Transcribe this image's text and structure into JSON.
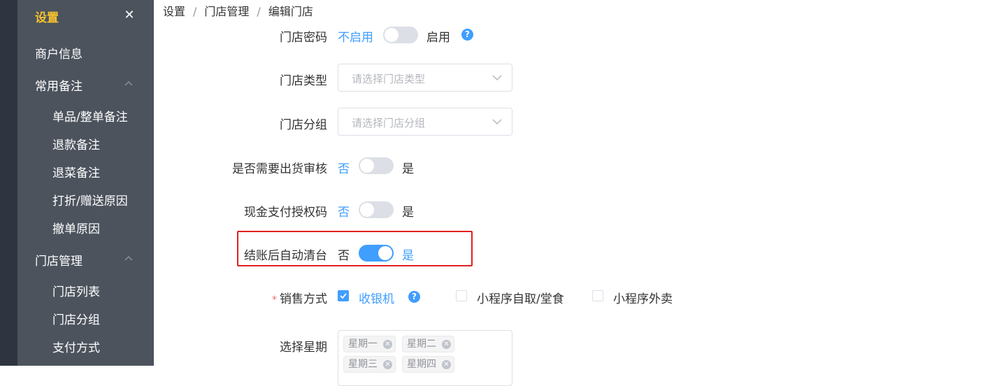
{
  "sidebar": {
    "title": "设置",
    "close_icon": "close-icon",
    "items": [
      {
        "label": "商户信息"
      },
      {
        "label": "常用备注"
      },
      {
        "label": "单品/整单备注"
      },
      {
        "label": "退款备注"
      },
      {
        "label": "退菜备注"
      },
      {
        "label": "打折/赠送原因"
      },
      {
        "label": "撤单原因"
      },
      {
        "label": "门店管理"
      },
      {
        "label": "门店列表"
      },
      {
        "label": "门店分组"
      },
      {
        "label": "支付方式"
      }
    ]
  },
  "breadcrumb": [
    "设置",
    "门店管理",
    "编辑门店"
  ],
  "form": {
    "store_password": {
      "label": "门店密码",
      "off": "不启用",
      "on": "启用"
    },
    "store_type": {
      "label": "门店类型",
      "placeholder": "请选择门店类型"
    },
    "store_group": {
      "label": "门店分组",
      "placeholder": "请选择门店分组"
    },
    "shipment_review": {
      "label": "是否需要出货审核",
      "off": "否",
      "on": "是"
    },
    "cash_auth_code": {
      "label": "现金支付授权码",
      "off": "否",
      "on": "是"
    },
    "auto_clear_table": {
      "label": "结账后自动清台",
      "off": "否",
      "on": "是"
    },
    "sales_method": {
      "required_mark": "*",
      "label": "销售方式",
      "options": [
        {
          "label": "收银机",
          "checked": true
        },
        {
          "label": "小程序自取/堂食",
          "checked": false
        },
        {
          "label": "小程序外卖",
          "checked": false
        }
      ]
    },
    "weekdays": {
      "label": "选择星期",
      "tags": [
        "星期一",
        "星期二",
        "星期三",
        "星期四"
      ]
    }
  },
  "colors": {
    "accent": "#409eff",
    "sidebar_bg": "#4c535d",
    "sidebar_title": "#f5c12e",
    "highlight": "#e02020"
  }
}
